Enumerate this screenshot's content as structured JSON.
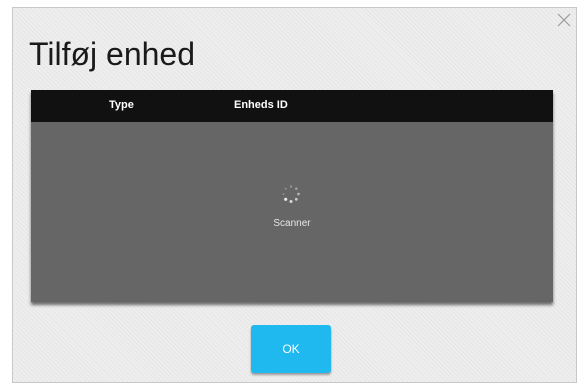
{
  "dialog": {
    "title": "Tilføj enhed",
    "close_icon": "close-icon"
  },
  "table": {
    "columns": [
      "Type",
      "Enheds ID"
    ],
    "rows": [],
    "loading_icon": "spinner-icon",
    "status_text": "Scanner"
  },
  "footer": {
    "ok_label": "OK"
  },
  "colors": {
    "accent": "#1fb8ef",
    "header_bg": "#111111",
    "table_bg": "#666666"
  }
}
